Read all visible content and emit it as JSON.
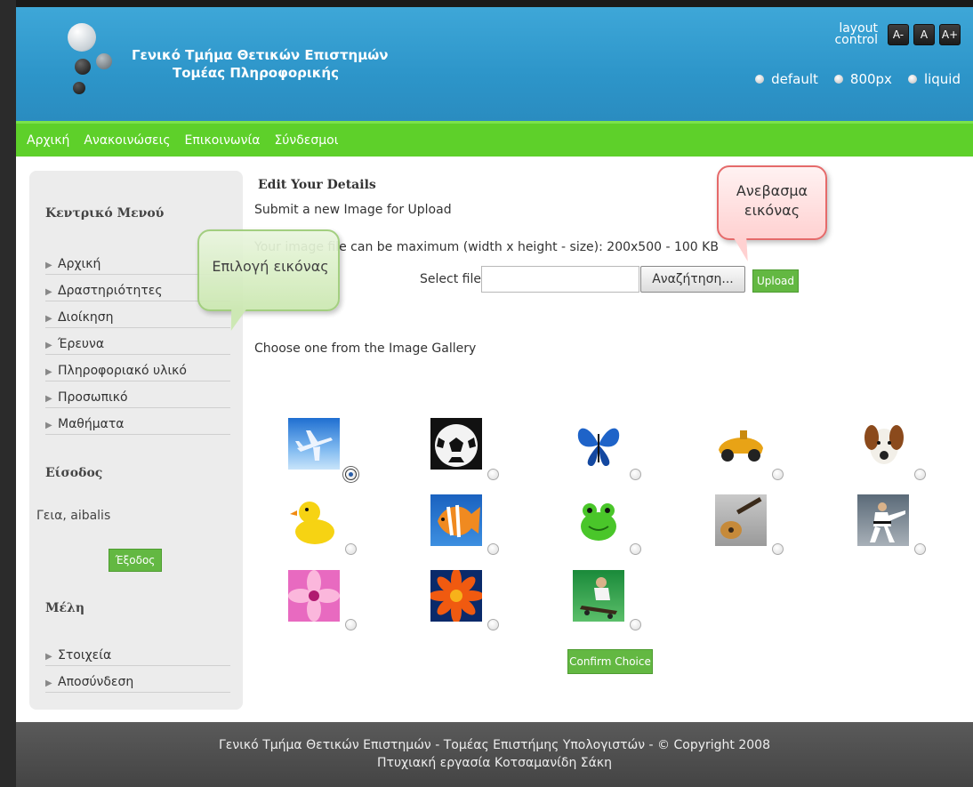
{
  "header": {
    "title_line1": "Γενικό Τμήμα Θετικών Επιστημών",
    "title_line2": "Τομέας Πληροφορικής",
    "layout_label_1": "layout",
    "layout_label_2": "control",
    "font_buttons": [
      "A-",
      "A",
      "A+"
    ],
    "width_options": [
      "default",
      "800px",
      "liquid"
    ]
  },
  "nav": {
    "items": [
      "Αρχική",
      "Ανακοινώσεις",
      "Επικοινωνία",
      "Σύνδεσμοι"
    ]
  },
  "sidebar": {
    "menu_title": "Κεντρικό Μενού",
    "menu_items": [
      "Αρχική",
      "Δραστηριότητες",
      "Διοίκηση",
      "Έρευνα",
      "Πληροφοριακό υλικό",
      "Προσωπικό",
      "Μαθήματα"
    ],
    "login_title": "Είσοδος",
    "greeting": "Γεια, aibalis",
    "logout_label": "Έξοδος",
    "members_title": "Μέλη",
    "member_items": [
      "Στοιχεία",
      "Αποσύνδεση"
    ]
  },
  "main": {
    "title": "Edit Your Details",
    "subtitle": "Submit a new Image for Upload",
    "note": "Your image file can be maximum (width x height - size): 200x500 - 100 KB",
    "select_label": "Select file",
    "browse_label": "Αναζήτηση...",
    "upload_label": "Upload",
    "gallery_label": "Choose one from the Image Gallery",
    "confirm_label": "Confirm Choice"
  },
  "callouts": {
    "green_text": "Επιλογή εικόνας",
    "red_line1": "Ανεβασμα",
    "red_line2": "εικόνας"
  },
  "gallery": {
    "images": [
      "airplane-image",
      "soccer-ball-image",
      "butterfly-image",
      "toy-car-image",
      "dog-image",
      "rubber-duck-image",
      "fish-image",
      "frog-image",
      "guitar-image",
      "karate-image",
      "flower-pink-image",
      "flower-orange-image",
      "skateboard-image"
    ],
    "selected_index": 0
  },
  "footer": {
    "line1": "Γενικό Τμήμα Θετικών Επιστημών - Τομέας Επιστήμης Υπολογιστών - © Copyright 2008",
    "line2": "Πτυχιακή εργασία Κοτσαμανίδη Σάκη"
  },
  "colors": {
    "header_blue": "#2d95c9",
    "nav_green": "#5ed02a",
    "button_green": "#63b842",
    "footer_gray": "#4e4e4e"
  }
}
